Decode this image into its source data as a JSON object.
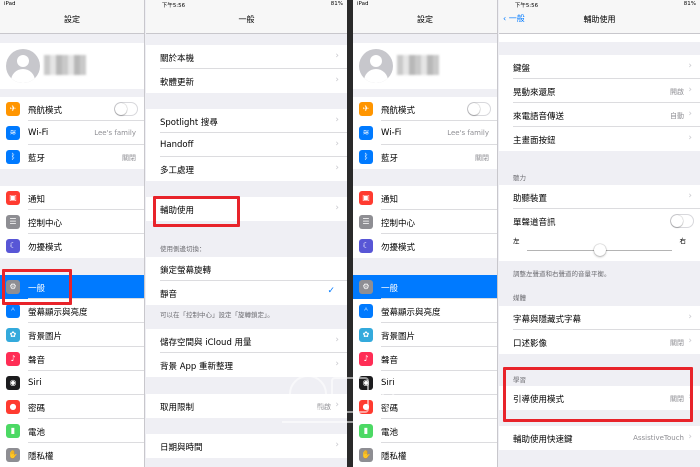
{
  "status_bar": {
    "carrier": "iPad",
    "time": "下午5:56",
    "battery": "81%"
  },
  "left_ipad": {
    "master": {
      "title": "設定",
      "items": [
        {
          "label": "飛航模式",
          "icon": "airplane-icon",
          "color": "#ff9500",
          "accessory": "toggle"
        },
        {
          "label": "Wi-Fi",
          "icon": "wifi-icon",
          "color": "#007aff",
          "value": "Lee's family"
        },
        {
          "label": "藍牙",
          "icon": "bluetooth-icon",
          "color": "#007aff",
          "value": "關閉"
        },
        {
          "label": "通知",
          "icon": "notifications-icon",
          "color": "#ff3b30"
        },
        {
          "label": "控制中心",
          "icon": "control-center-icon",
          "color": "#8e8e93"
        },
        {
          "label": "勿擾模式",
          "icon": "moon-icon",
          "color": "#5856d6"
        },
        {
          "label": "一般",
          "icon": "gear-icon",
          "color": "#8e8e93",
          "selected": true
        },
        {
          "label": "螢幕顯示與亮度",
          "icon": "display-icon",
          "color": "#007aff"
        },
        {
          "label": "背景圖片",
          "icon": "wallpaper-icon",
          "color": "#34aadc"
        },
        {
          "label": "聲音",
          "icon": "sound-icon",
          "color": "#ff2d55"
        },
        {
          "label": "Siri",
          "icon": "siri-icon",
          "color": "#1c1c1e"
        },
        {
          "label": "密碼",
          "icon": "passcode-icon",
          "color": "#ff3b30"
        },
        {
          "label": "電池",
          "icon": "battery-icon",
          "color": "#4cd964"
        },
        {
          "label": "隱私權",
          "icon": "privacy-hand-icon",
          "color": "#8e8e93"
        }
      ]
    },
    "detail": {
      "title": "一般",
      "group1": [
        "關於本機",
        "軟體更新"
      ],
      "group2": [
        "Spotlight 搜尋",
        "Handoff",
        "多工處理"
      ],
      "group3": [
        "輔助使用"
      ],
      "side_switch_header": "使用側邊切換：",
      "side_switch": [
        {
          "label": "鎖定螢幕旋轉",
          "checked": false
        },
        {
          "label": "靜音",
          "checked": true
        }
      ],
      "side_switch_footer": "可以在「控制中心」設定「旋轉鎖定」。",
      "group4": [
        "儲存空間與 iCloud 用量",
        "背景 App 重新整理"
      ],
      "restrictions": {
        "label": "取用限制",
        "value": "開啟"
      },
      "date_time": "日期與時間"
    }
  },
  "right_ipad": {
    "master": {
      "title": "設定",
      "items": [
        {
          "label": "飛航模式",
          "icon": "airplane-icon",
          "color": "#ff9500",
          "accessory": "toggle"
        },
        {
          "label": "Wi-Fi",
          "icon": "wifi-icon",
          "color": "#007aff",
          "value": "Lee's family"
        },
        {
          "label": "藍牙",
          "icon": "bluetooth-icon",
          "color": "#007aff",
          "value": "關閉"
        },
        {
          "label": "通知",
          "icon": "notifications-icon",
          "color": "#ff3b30"
        },
        {
          "label": "控制中心",
          "icon": "control-center-icon",
          "color": "#8e8e93"
        },
        {
          "label": "勿擾模式",
          "icon": "moon-icon",
          "color": "#5856d6"
        },
        {
          "label": "一般",
          "icon": "gear-icon",
          "color": "#8e8e93",
          "selected": true
        },
        {
          "label": "螢幕顯示與亮度",
          "icon": "display-icon",
          "color": "#007aff"
        },
        {
          "label": "背景圖片",
          "icon": "wallpaper-icon",
          "color": "#34aadc"
        },
        {
          "label": "聲音",
          "icon": "sound-icon",
          "color": "#ff2d55"
        },
        {
          "label": "Siri",
          "icon": "siri-icon",
          "color": "#1c1c1e"
        },
        {
          "label": "密碼",
          "icon": "passcode-icon",
          "color": "#ff3b30"
        },
        {
          "label": "電池",
          "icon": "battery-icon",
          "color": "#4cd964"
        },
        {
          "label": "隱私權",
          "icon": "privacy-hand-icon",
          "color": "#8e8e93"
        }
      ]
    },
    "detail": {
      "back_label": "一般",
      "title": "輔助使用",
      "interaction": [
        {
          "label": "鍵盤"
        },
        {
          "label": "晃動來還原",
          "value": "開啟"
        },
        {
          "label": "來電語音傳送",
          "value": "自動"
        },
        {
          "label": "主畫面按鈕"
        }
      ],
      "hearing_header": "聽力",
      "hearing": [
        {
          "label": "助聽裝置"
        },
        {
          "label": "單聲道音訊",
          "accessory": "toggle"
        }
      ],
      "balance": {
        "left": "左",
        "right": "右",
        "level": 0.5
      },
      "balance_footer": "調整左聲道和右聲道的音量平衡。",
      "media_header": "媒體",
      "media": [
        {
          "label": "字幕與隱藏式字幕"
        },
        {
          "label": "口述影像",
          "value": "關閉"
        }
      ],
      "learning_header": "學習",
      "guided_access": {
        "label": "引導使用模式",
        "value": "關閉"
      },
      "shortcut": {
        "label": "輔助使用快速鍵",
        "value": "AssistiveTouch"
      }
    }
  },
  "colors": {
    "highlight": "#e8232a",
    "accent": "#007aff",
    "background": "#efeff4"
  }
}
